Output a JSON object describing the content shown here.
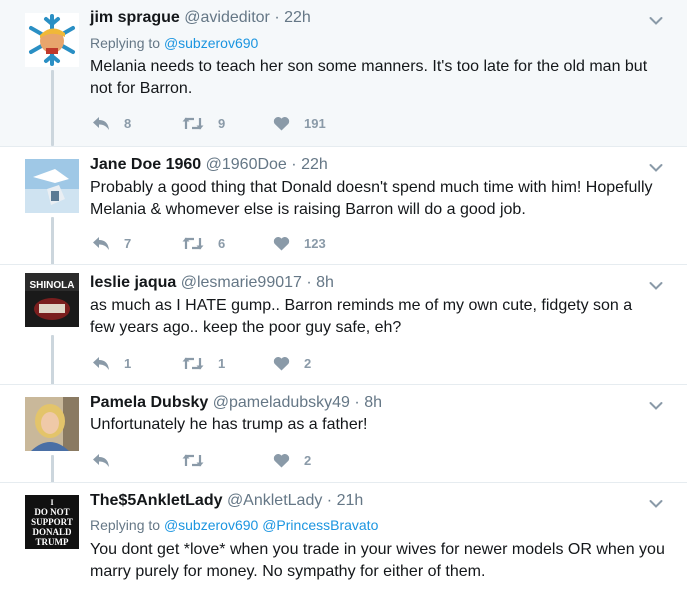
{
  "tweets": [
    {
      "name": "jim sprague",
      "handle": "@avideditor",
      "time": "22h",
      "replying_label": "Replying to",
      "replying_to": [
        "@subzerov690"
      ],
      "text": "Melania needs to teach her son some manners.  It's too late for the old man but not for Barron.",
      "replies": "8",
      "retweets": "9",
      "likes": "191",
      "avatar_icon": "snowflake-trump-avatar"
    },
    {
      "name": "Jane Doe 1960",
      "handle": "@1960Doe",
      "time": "22h",
      "text": "Probably a good thing that Donald doesn't spend much time with him! Hopefully Melania & whomever else is raising Barron will do a good job.",
      "replies": "7",
      "retweets": "6",
      "likes": "123",
      "avatar_icon": "sky-photo-avatar"
    },
    {
      "name": "leslie jaqua",
      "handle": "@lesmarie99017",
      "time": "8h",
      "text": "as much as I HATE gump.. Barron reminds me of my own cute, fidgety son a few years ago.. keep the poor guy safe, eh?",
      "replies": "1",
      "retweets": "1",
      "likes": "2",
      "avatar_text": "SHINOLA",
      "avatar_icon": "shinola-cap-avatar"
    },
    {
      "name": "Pamela Dubsky",
      "handle": "@pameladubsky49",
      "time": "8h",
      "text": "Unfortunately he has trump as a father!",
      "replies": "",
      "retweets": "",
      "likes": "2",
      "avatar_icon": "woman-portrait-avatar"
    },
    {
      "name": "The$5AnkletLady",
      "handle": "@AnkletLady",
      "time": "21h",
      "replying_label": "Replying to",
      "replying_to": [
        "@subzerov690",
        "@PrincessBravato"
      ],
      "text": "You dont get *love* when you trade in your wives for newer models OR when you marry purely for money. No sympathy for either of them.",
      "avatar_lines": [
        "I",
        "DO NOT",
        "SUPPORT",
        "DONALD",
        "TRUMP"
      ],
      "avatar_icon": "do-not-support-sign-avatar"
    }
  ],
  "separator": "·",
  "icons": {
    "reply": "reply-icon",
    "retweet": "retweet-icon",
    "like": "heart-icon",
    "menu": "chevron-down-icon"
  },
  "colors": {
    "link": "#1b95e0",
    "muted": "#657786",
    "action": "#8a9aa8",
    "thread": "#ccd6dd",
    "highlight_bg": "#f5f8fa"
  }
}
